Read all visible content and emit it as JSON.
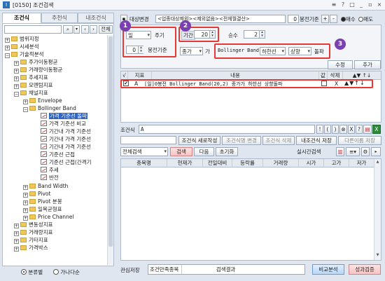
{
  "window": {
    "code": "[0150]",
    "title": "조건검색",
    "icon": "I",
    "controls": [
      "≡",
      "?",
      "□",
      "_",
      "▫",
      "×"
    ]
  },
  "left": {
    "tabs": [
      "조건식",
      "추천식",
      "내조건식"
    ],
    "search_button": "전체",
    "tree": [
      {
        "label": "범위지정",
        "toggle": "+"
      },
      {
        "label": "시세분석",
        "toggle": "+"
      },
      {
        "label": "기술적분석",
        "toggle": "−"
      },
      {
        "label": "주가이동평균",
        "toggle": "+"
      },
      {
        "label": "거래량이동평균",
        "toggle": "+"
      },
      {
        "label": "추세지표",
        "toggle": "+"
      },
      {
        "label": "모멘텀지표",
        "toggle": "+"
      },
      {
        "label": "채널지표",
        "toggle": "−"
      },
      {
        "label": "Envelope",
        "toggle": "+"
      },
      {
        "label": "Bollinger Band",
        "toggle": "−"
      },
      {
        "label": "가격 기준선 돌파"
      },
      {
        "label": "가격 기준선 비교"
      },
      {
        "label": "기간내 가격 기준선"
      },
      {
        "label": "기간내 가격 기준선"
      },
      {
        "label": "기간내 가격 기준선"
      },
      {
        "label": "기준선 근접"
      },
      {
        "label": "기준선 근접(간격기"
      },
      {
        "label": "추세"
      },
      {
        "label": "반전"
      },
      {
        "label": "Band Width",
        "toggle": "+"
      },
      {
        "label": "Pivot",
        "toggle": "+"
      },
      {
        "label": "Pivot 분봉",
        "toggle": "+"
      },
      {
        "label": "일목균형표",
        "toggle": "+"
      },
      {
        "label": "Price Channel",
        "toggle": "+"
      },
      {
        "label": "변동성지표",
        "toggle": "+"
      },
      {
        "label": "거래량지표",
        "toggle": "+"
      },
      {
        "label": "기타지표",
        "toggle": "+"
      },
      {
        "label": "가격박스",
        "toggle": "+"
      }
    ],
    "radio": [
      "분류별",
      "가나다순"
    ]
  },
  "top": {
    "target_change": "대상변경",
    "target_text": "<업종대상제외><제외없음><전체월결산>",
    "bong_value": "0",
    "bong_label": "봉전기준",
    "plus": "+",
    "minus": "-",
    "buy": "매수",
    "sell": "매도"
  },
  "params": {
    "period_unit": "일",
    "cycle_label": "주기",
    "bong_value": "0",
    "bong_label": "봉전기준",
    "period_label": "기간",
    "period_value": "20",
    "mult_label": "승수",
    "mult_value": "2",
    "price_type": "종가",
    "ga": "가",
    "indicator": "Bollinger Band",
    "line": "하한선",
    "direction": "상향",
    "action": "돌파",
    "modify_btn": "수정",
    "add_btn": "추가",
    "badges": [
      "1",
      "2",
      "3"
    ]
  },
  "cond_grid": {
    "headers": [
      "√",
      "지표",
      "내용",
      "값",
      "삭제",
      "▲▼ ↑↓"
    ],
    "row": {
      "letter": "A",
      "content": "[일]0봉전 Bollinger Band(20,2) 종가가 하한선 상향돌파",
      "delete": "X"
    }
  },
  "formula": {
    "label": "조건식",
    "value": "A",
    "ops": [
      "!",
      "(",
      ")",
      "⊗",
      "X",
      "?"
    ],
    "buttons": [
      "조건식 새로작성",
      "조건식명 변경",
      "조건식 삭제",
      "내조건식 저장",
      "다른이름 저장"
    ]
  },
  "search": {
    "scope": "전체검색",
    "search_btn": "검색",
    "next_btn": "다음",
    "reset_btn": "초기화",
    "realtime": "실시간검색"
  },
  "result_grid": {
    "headers": [
      "종목명",
      "현재가",
      "전일대비",
      "등락률",
      "거래량",
      "시가",
      "고가",
      "저가"
    ]
  },
  "bottom": {
    "fav_save": "관심저장",
    "met_label": "조건만족종목",
    "result_label": "검색결과",
    "compare_btn": "비교분석",
    "perf_btn": "성과검증"
  },
  "colors": {
    "accent_red": "#e53935",
    "badge_purple": "#7b3fb1",
    "selection_blue": "#2d64c8"
  }
}
